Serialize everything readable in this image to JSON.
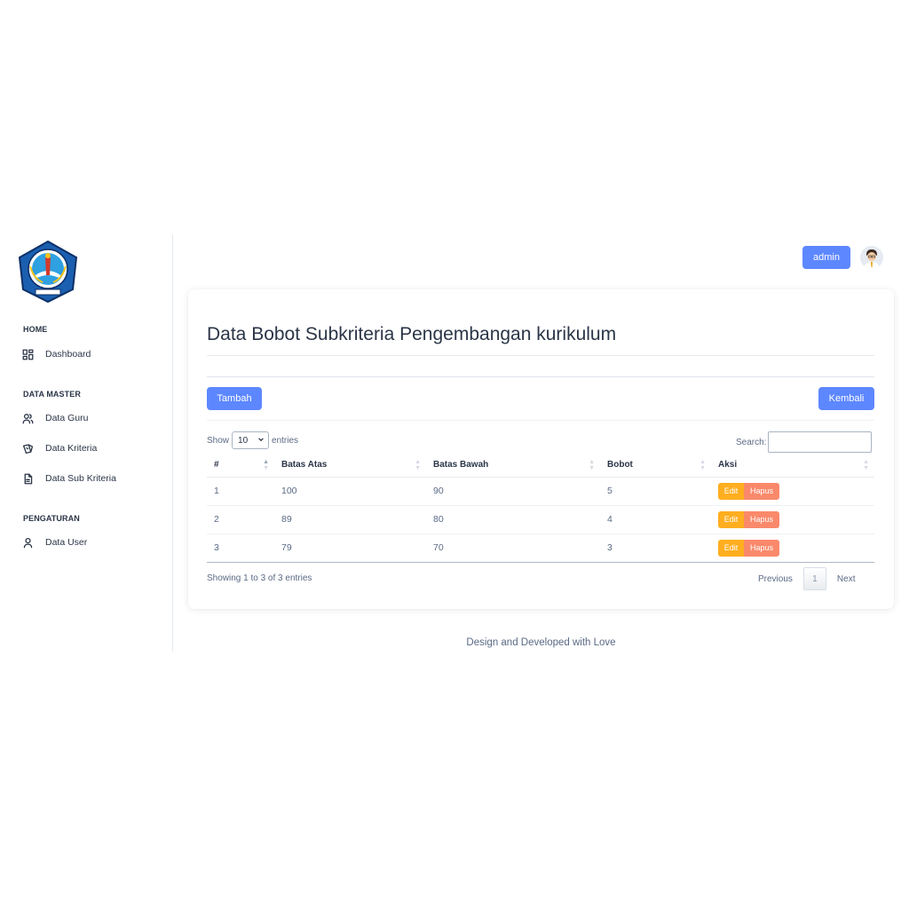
{
  "sidebar": {
    "sections": [
      {
        "title": "HOME",
        "items": [
          {
            "label": "Dashboard",
            "icon": "dashboard-icon"
          }
        ]
      },
      {
        "title": "DATA MASTER",
        "items": [
          {
            "label": "Data Guru",
            "icon": "users-icon"
          },
          {
            "label": "Data Kriteria",
            "icon": "cards-icon"
          },
          {
            "label": "Data Sub Kriteria",
            "icon": "file-text-icon"
          }
        ]
      },
      {
        "title": "PENGATURAN",
        "items": [
          {
            "label": "Data User",
            "icon": "user-icon"
          }
        ]
      }
    ]
  },
  "header": {
    "user_label": "admin"
  },
  "main": {
    "title": "Data Bobot Subkriteria Pengembangan kurikulum",
    "add_label": "Tambah",
    "back_label": "Kembali",
    "show_label": "Show",
    "entries_value": "10",
    "entries_label": "entries",
    "search_label": "Search:",
    "search_value": "",
    "columns": [
      "#",
      "Batas Atas",
      "Batas Bawah",
      "Bobot",
      "Aksi"
    ],
    "rows": [
      {
        "no": "1",
        "batas_atas": "100",
        "batas_bawah": "90",
        "bobot": "5"
      },
      {
        "no": "2",
        "batas_atas": "89",
        "batas_bawah": "80",
        "bobot": "4"
      },
      {
        "no": "3",
        "batas_atas": "79",
        "batas_bawah": "70",
        "bobot": "3"
      }
    ],
    "edit_label": "Edit",
    "delete_label": "Hapus",
    "info_text": "Showing 1 to 3 of 3 entries",
    "pagination": {
      "previous": "Previous",
      "current_page": "1",
      "next": "Next"
    }
  },
  "footer": {
    "text": "Design and Developed with Love"
  },
  "colors": {
    "primary": "#5d87ff",
    "warning": "#ffae1f",
    "danger": "#fa896b",
    "text": "#2a3547",
    "muted": "#5a6a85"
  }
}
